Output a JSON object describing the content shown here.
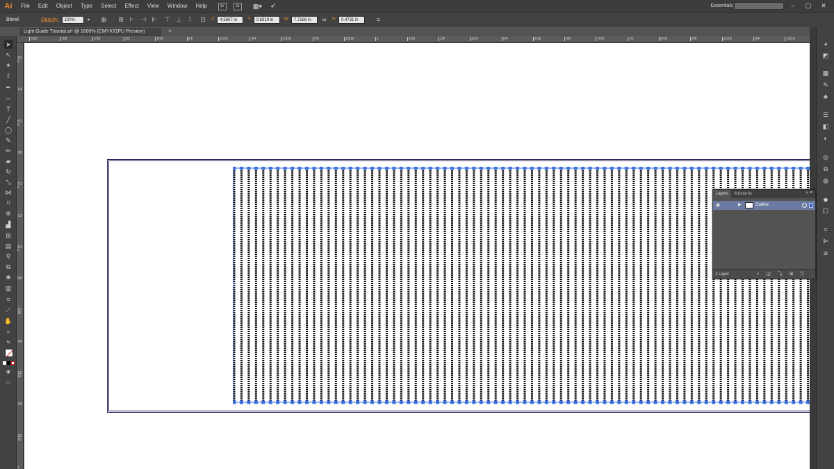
{
  "app": {
    "logo": "Ai"
  },
  "menu": [
    "File",
    "Edit",
    "Object",
    "Type",
    "Select",
    "Effect",
    "View",
    "Window",
    "Help"
  ],
  "menu_badges": [
    "Br",
    "St"
  ],
  "workspace": {
    "label": "Essentials",
    "chevron": "▾"
  },
  "search": {
    "placeholder": ""
  },
  "control_bar": {
    "selection_label": "Blend",
    "opacity_label": "Opacity:",
    "opacity_value": "100%",
    "x_label": "X:",
    "x_value": "4.5807 in",
    "y_label": "Y:",
    "y_value": "0.6319 in",
    "w_label": "W:",
    "w_value": "7.7168 in",
    "h_label": "H:",
    "h_value": "0.4731 in"
  },
  "document_tab": {
    "title": "Light Guide Tutorial.ai* @ 1600% (CMYK/GPU Preview)",
    "close": "×"
  },
  "ruler_top_labels": [
    "5/16",
    "3/8",
    "7/16",
    "1/2",
    "9/16",
    "5/8",
    "11/16",
    "3/4",
    "13/16",
    "7/8",
    "15/16",
    "1",
    "1/16",
    "1/8",
    "3/16",
    "1/4",
    "5/16",
    "3/8",
    "7/16",
    "1/2",
    "9/16",
    "5/8",
    "11/16",
    "3/4",
    "13/16"
  ],
  "ruler_left_labels": [
    "3/16",
    "1/4",
    "5/16",
    "3/8",
    "7/16",
    "1/2",
    "9/16",
    "5/8",
    "11/16",
    "3/4",
    "13/16",
    "7/8",
    "15/16",
    "1"
  ],
  "layers_panel": {
    "tabs": [
      "Layers",
      "Artboards"
    ],
    "layer_name": "Outline",
    "layer_count": "1 Layer"
  },
  "colors": {
    "accent": "#e8892a",
    "selection": "#3b6fe0",
    "layer_row": "#6a7aa0"
  },
  "icons": [
    "selection-icon",
    "direct-selection-icon",
    "magic-wand-icon",
    "lasso-icon",
    "pen-icon",
    "type-icon",
    "line-icon",
    "rectangle-icon",
    "paintbrush-icon",
    "pencil-icon",
    "eraser-icon",
    "rotate-icon",
    "scale-icon",
    "width-icon",
    "free-transform-icon",
    "shape-builder-icon",
    "perspective-icon",
    "mesh-icon",
    "gradient-icon",
    "eyedropper-icon",
    "blend-icon",
    "symbol-sprayer-icon",
    "column-graph-icon",
    "artboard-icon",
    "slice-icon",
    "hand-icon",
    "zoom-icon"
  ]
}
